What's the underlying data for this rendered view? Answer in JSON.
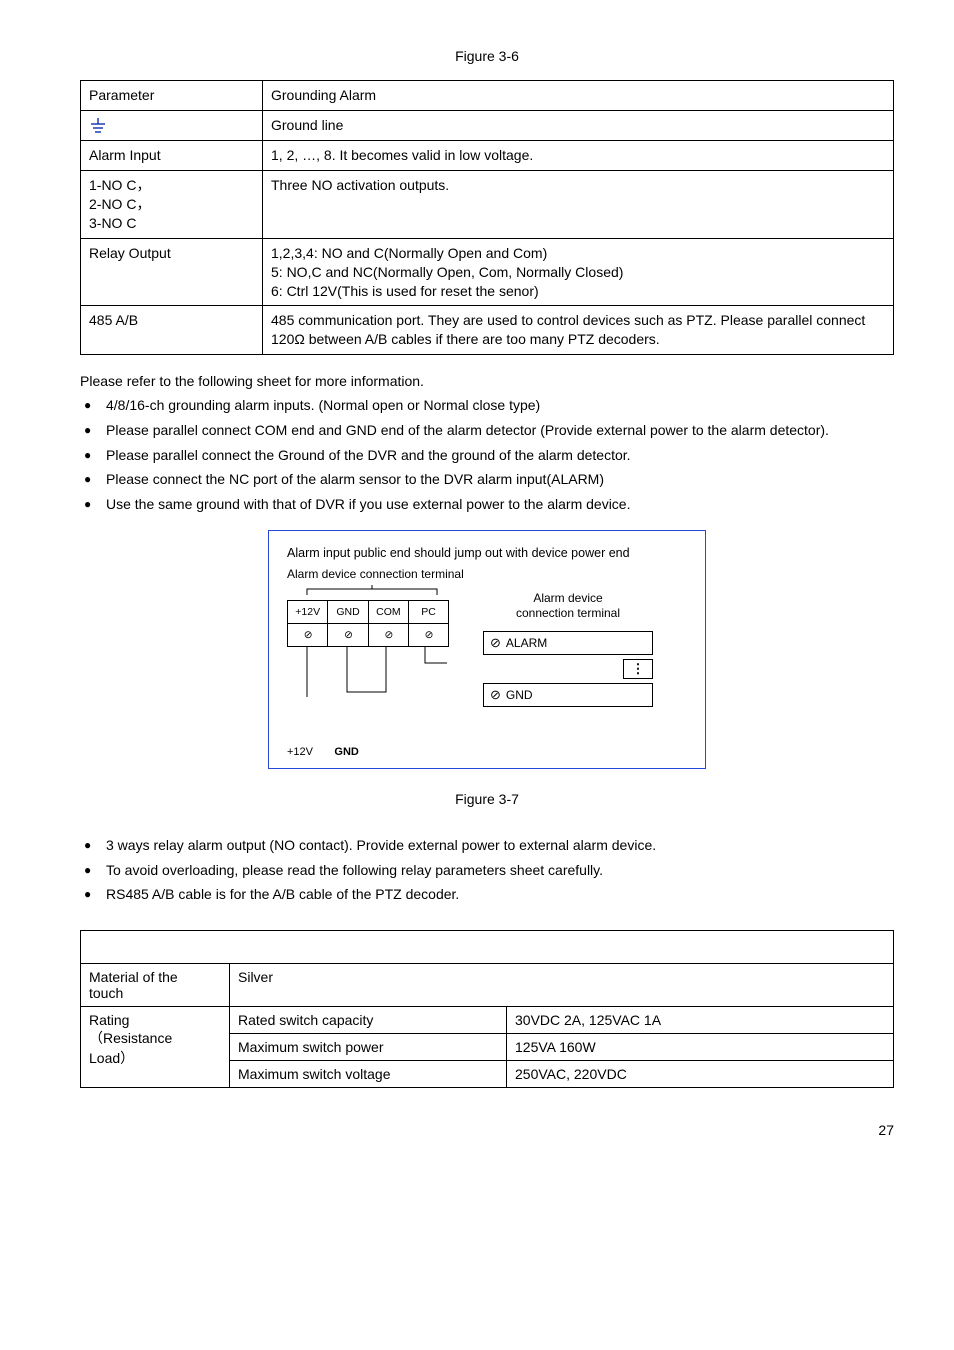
{
  "fig_top": "Figure 3-6",
  "table1": {
    "r0c0": "Parameter",
    "r0c1": "Grounding Alarm",
    "r1c1": "Ground line",
    "r2c0": "Alarm Input",
    "r2c1": "1, 2, …, 8. It becomes valid in low voltage.",
    "r3c0a": "1-NO C，",
    "r3c0b": "2-NO C，",
    "r3c0c": "3-NO C",
    "r3c1": "Three NO activation outputs.",
    "r4c0": "Relay Output",
    "r4c1a": "1,2,3,4: NO and C(Normally Open and Com)",
    "r4c1b": "5: NO,C and NC(Normally Open, Com, Normally Closed)",
    "r4c1c": "6: Ctrl 12V(This is used for reset the senor)",
    "r5c0": "485 A/B",
    "r5c1": "485 communication port. They are used to control devices such as PTZ. Please parallel connect 120Ω between A/B cables if there are too many PTZ decoders."
  },
  "para1": "Please refer to the following sheet for more information.",
  "list1": {
    "i1": "4/8/16-ch grounding alarm inputs. (Normal open or Normal close type)",
    "i2": "Please parallel connect COM end and GND end of the alarm detector (Provide external power to the alarm detector).",
    "i3": "Please parallel connect the Ground of the DVR and the ground of the alarm detector.",
    "i4": "Please connect the NC port of the alarm sensor to the DVR alarm input(ALARM)",
    "i5": "Use the same ground with that of DVR if you use external power to the alarm device."
  },
  "diagram": {
    "title": "Alarm input public end should jump out with device power end",
    "sub": "Alarm device connection terminal",
    "c1": "+12V",
    "c2": "GND",
    "c3": "COM",
    "c4": "PC",
    "devlabel1": "Alarm device",
    "devlabel2": "connection terminal",
    "box_alarm": "ALARM",
    "box_gnd": "GND",
    "bottom_12v": "+12V",
    "bottom_gnd": "GND"
  },
  "fig_mid": "Figure 3-7",
  "list2": {
    "i1": "3 ways relay alarm output (NO contact). Provide external power to external alarm device.",
    "i2": "To avoid overloading, please read the following relay parameters sheet carefully.",
    "i3": "RS485 A/B cable is for the A/B cable of the PTZ decoder."
  },
  "spec": {
    "material_label1": "Material of the",
    "material_label2": "touch",
    "material_val": "Silver",
    "rating1": "Rating",
    "rating2": "（Resistance",
    "rating3": "Load）",
    "row1a": "Rated switch capacity",
    "row1b": "30VDC 2A, 125VAC 1A",
    "row2a": "Maximum switch power",
    "row2b": "125VA 160W",
    "row3a": "Maximum switch voltage",
    "row3b": "250VAC, 220VDC"
  },
  "page": "27"
}
